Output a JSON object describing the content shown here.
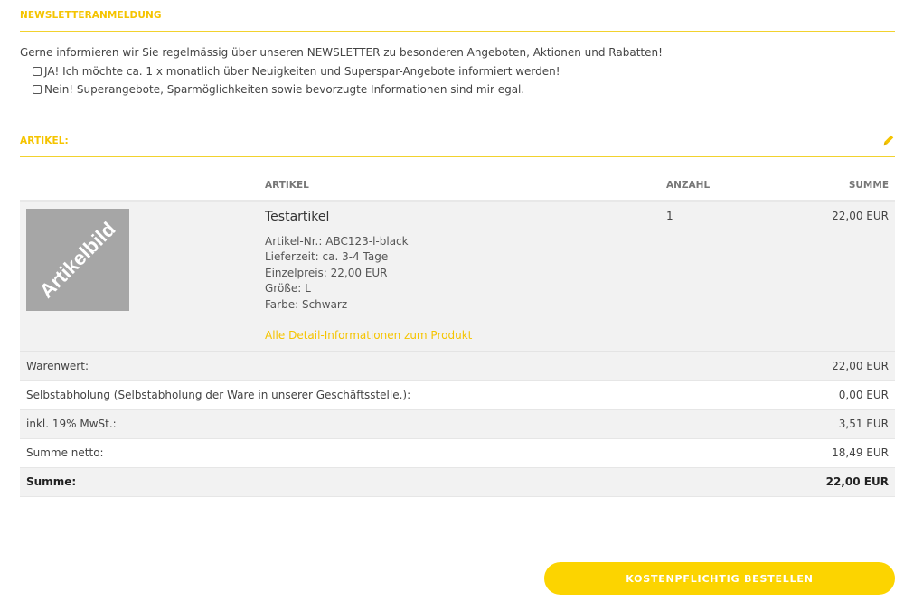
{
  "newsletter": {
    "title": "NEWSLETTERANMELDUNG",
    "intro": "Gerne informieren wir Sie regelmässig über unseren NEWSLETTER zu besonderen Angeboten, Aktionen und Rabatten!",
    "options": [
      {
        "label": "JA! Ich möchte ca. 1 x monatlich über Neuigkeiten und Superspar-Angebote informiert werden!",
        "checked": false
      },
      {
        "label": "Nein! Superangebote, Sparmöglichkeiten sowie bevorzugte Informationen sind mir egal.",
        "checked": false
      }
    ]
  },
  "articles": {
    "title": "ARTIKEL:",
    "edit_icon": "pencil-icon",
    "columns": {
      "article": "ARTIKEL",
      "quantity": "ANZAHL",
      "sum": "SUMME"
    },
    "item": {
      "image_text": "Artikelbild",
      "name": "Testartikel",
      "details": [
        "Artikel-Nr.: ABC123-l-black",
        "Lieferzeit: ca. 3-4 Tage",
        "Einzelpreis: 22,00 EUR",
        "Größe: L",
        "Farbe: Schwarz"
      ],
      "link": "Alle Detail-Informationen zum Produkt",
      "quantity": "1",
      "sum": "22,00 EUR"
    }
  },
  "totals": [
    {
      "label": "Warenwert:",
      "value": "22,00 EUR"
    },
    {
      "label": "Selbstabholung (Selbstabholung der Ware in unserer Geschäftsstelle.):",
      "value": "0,00 EUR"
    },
    {
      "label": "inkl. 19% MwSt.:",
      "value": "3,51 EUR"
    },
    {
      "label": "Summe netto:",
      "value": "18,49 EUR"
    },
    {
      "label": "Summe:",
      "value": "22,00 EUR"
    }
  ],
  "order_button": "KOSTENPFLICHTIG BESTELLEN",
  "colors": {
    "accent": "#fcd400",
    "heading": "#f5c400",
    "row_grey": "#f2f2f2"
  }
}
